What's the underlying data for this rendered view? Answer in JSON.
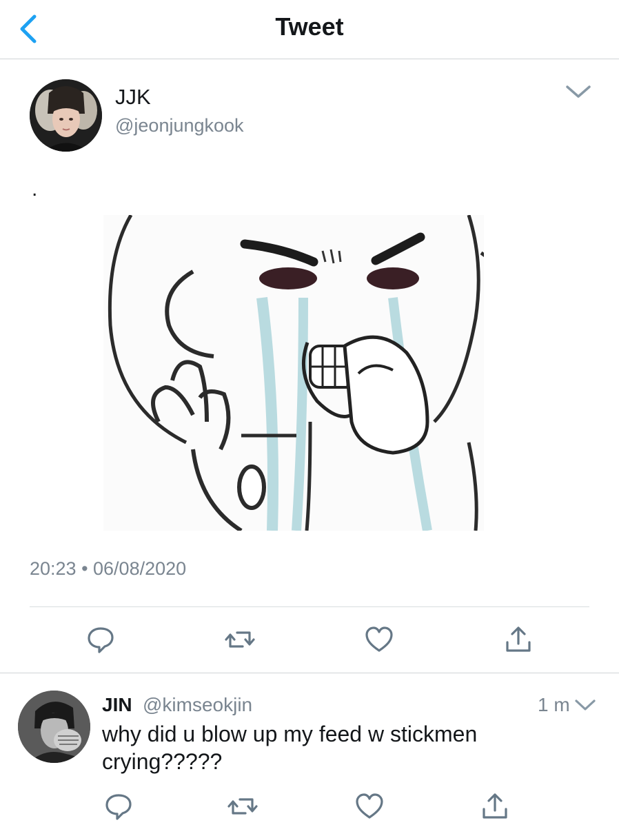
{
  "header": {
    "title": "Tweet",
    "back_icon": "chevron-left-icon"
  },
  "tweet": {
    "name": "JJK",
    "handle": "@jeonjungkook",
    "text": ".",
    "media_description_icon": "crying-stickman-image",
    "timestamp": "20:23 • 06/08/2020",
    "actions": [
      "reply-icon",
      "retweet-icon",
      "like-icon",
      "share-icon"
    ]
  },
  "reply": {
    "name": "JIN",
    "handle": "@kimseokjin",
    "time": "1 m",
    "text": "why did u blow up my feed w stickmen crying?????",
    "actions": [
      "reply-icon",
      "retweet-icon",
      "like-icon",
      "share-icon"
    ]
  },
  "colors": {
    "accent": "#1da1f2",
    "text": "#14171a",
    "secondary_text": "#7a8590",
    "icon": "#657786",
    "divider": "#d8dcdf"
  }
}
